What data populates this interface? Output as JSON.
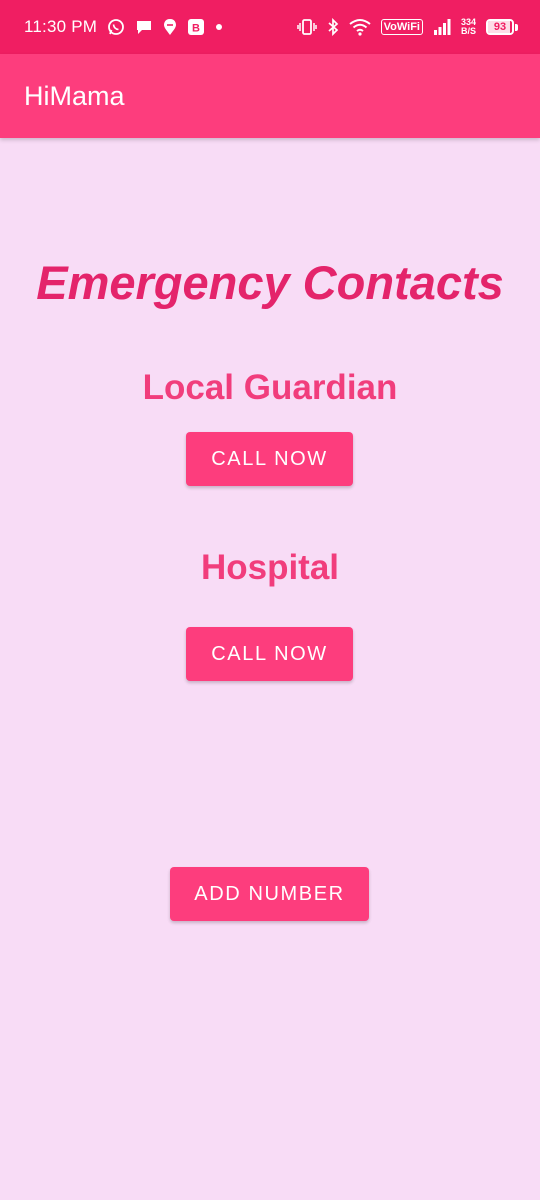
{
  "status_bar": {
    "time": "11:30 PM",
    "app_badge": "B",
    "vowifi": "VoWiFi",
    "net_speed_value": "334",
    "net_speed_unit": "B/S",
    "battery_level": "93",
    "battery_percent": 93
  },
  "app_bar": {
    "title": "HiMama"
  },
  "main": {
    "heading": "Emergency Contacts",
    "contacts": [
      {
        "name": "Local Guardian",
        "button_label": "CALL NOW"
      },
      {
        "name": "Hospital",
        "button_label": "CALL NOW"
      }
    ],
    "add_button_label": "ADD NUMBER"
  },
  "colors": {
    "status_bar": "#f01e62",
    "app_bar": "#fd3d7d",
    "background": "#f8dcf6",
    "heading": "#e4246b",
    "contact_name": "#f13d7c",
    "button": "#fd3d7d"
  }
}
